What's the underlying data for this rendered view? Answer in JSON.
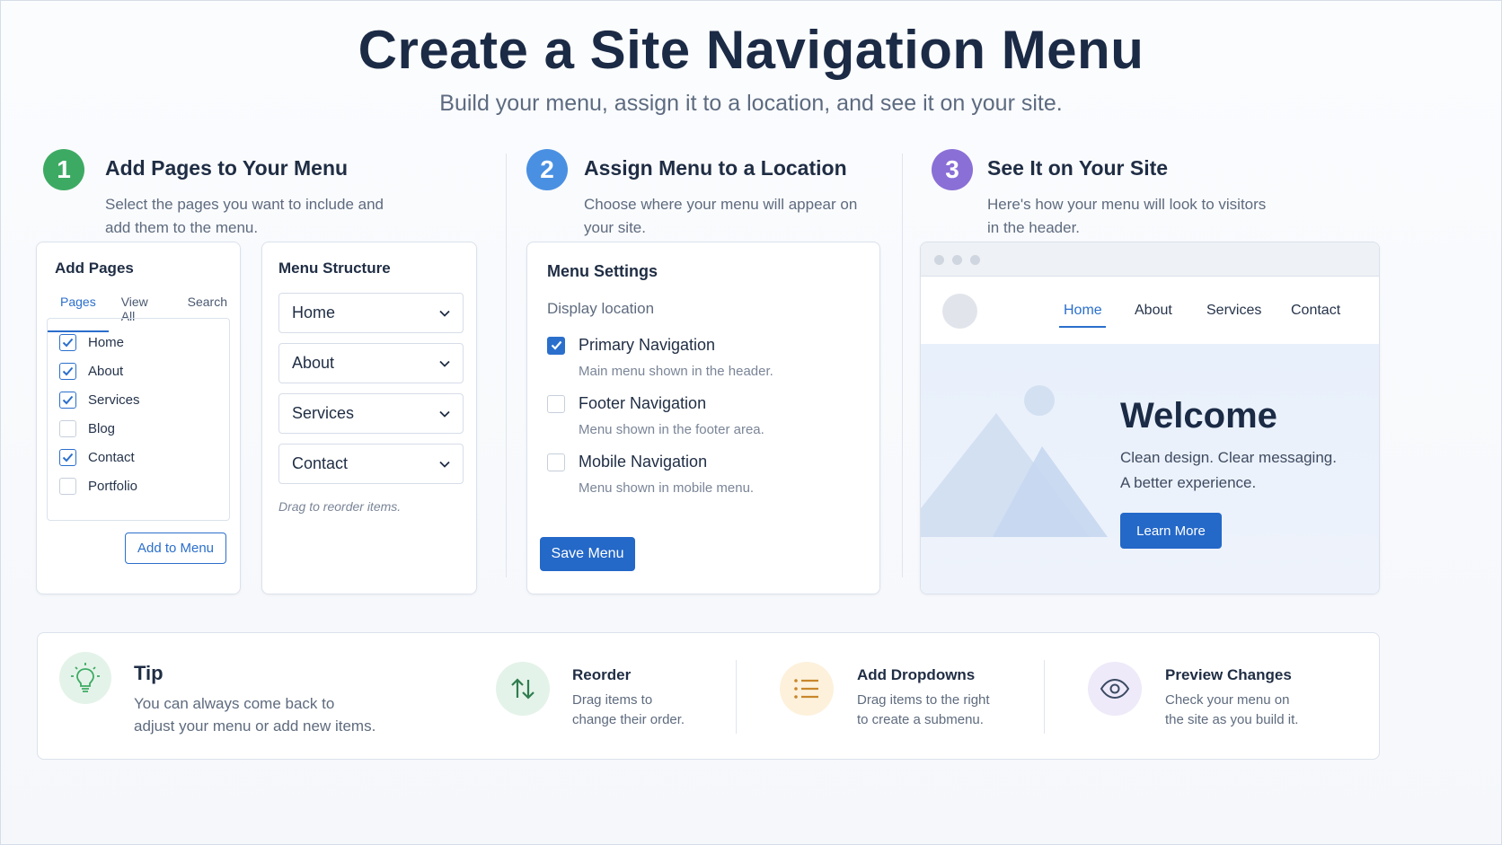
{
  "header": {
    "title": "Create a Site Navigation Menu",
    "subtitle": "Build your menu, assign it to a location, and see it on your site."
  },
  "colors": {
    "green": "#3daa63",
    "blue": "#4a90e2",
    "purple": "#8a6fd6",
    "accent": "#2b6fcc"
  },
  "steps": [
    {
      "number": "1",
      "title": "Add Pages to Your Menu",
      "desc_line1": "Select the pages you want to include and",
      "desc_line2": "add them to the menu."
    },
    {
      "number": "2",
      "title": "Assign Menu to a Location",
      "desc_line1": "Choose where your menu will appear on",
      "desc_line2": "your site."
    },
    {
      "number": "3",
      "title": "See It on Your Site",
      "desc_line1": "Here's how your menu will look to visitors",
      "desc_line2": "in the header."
    }
  ],
  "add_pages": {
    "title": "Add Pages",
    "tabs": [
      "Pages",
      "View All",
      "Search"
    ],
    "items": [
      {
        "label": "Home",
        "checked": true
      },
      {
        "label": "About",
        "checked": true
      },
      {
        "label": "Services",
        "checked": true
      },
      {
        "label": "Blog",
        "checked": false
      },
      {
        "label": "Contact",
        "checked": true
      },
      {
        "label": "Portfolio",
        "checked": false
      }
    ],
    "button": "Add to Menu"
  },
  "menu_structure": {
    "title": "Menu Structure",
    "items": [
      "Home",
      "About",
      "Services",
      "Contact"
    ],
    "hint": "Drag to reorder items."
  },
  "menu_settings": {
    "title": "Menu Settings",
    "location_label": "Display location",
    "options": [
      {
        "label": "Primary Navigation",
        "desc": "Main menu shown in the header.",
        "checked": true
      },
      {
        "label": "Footer Navigation",
        "desc": "Menu shown in the footer area.",
        "checked": false
      },
      {
        "label": "Mobile Navigation",
        "desc": "Menu shown in mobile menu.",
        "checked": false
      }
    ],
    "button": "Save Menu"
  },
  "preview": {
    "nav": [
      "Home",
      "About",
      "Services",
      "Contact"
    ],
    "active": "Home",
    "hero_title": "Welcome",
    "hero_line1": "Clean design. Clear messaging.",
    "hero_line2": "A better experience.",
    "button": "Learn More"
  },
  "tips": {
    "tip_title": "Tip",
    "tip_line1": "You can always come back to",
    "tip_line2": "adjust your menu or add new items.",
    "items": [
      {
        "icon": "arrows-up-down-icon",
        "title": "Reorder",
        "line1": "Drag items to",
        "line2": "change their order."
      },
      {
        "icon": "list-icon",
        "title": "Add Dropdowns",
        "line1": "Drag items to the right",
        "line2": "to create a submenu."
      },
      {
        "icon": "eye-icon",
        "title": "Preview Changes",
        "line1": "Check your menu on",
        "line2": "the site as you build it."
      }
    ]
  }
}
